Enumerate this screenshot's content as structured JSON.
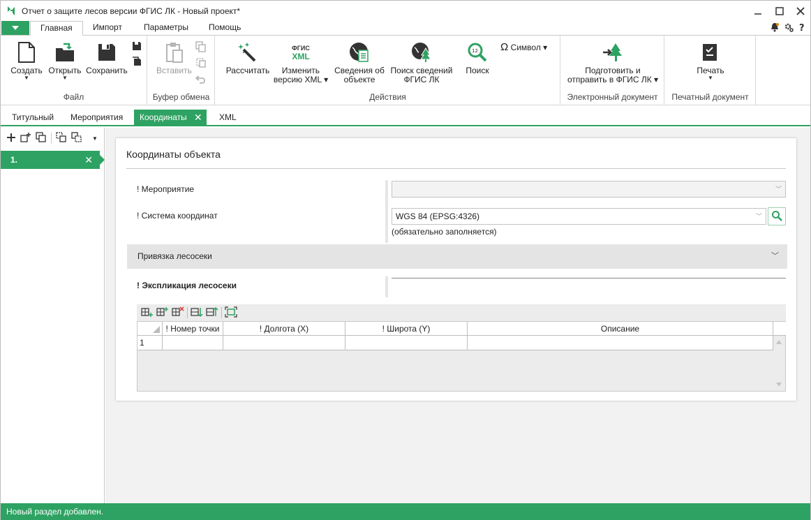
{
  "window": {
    "title": "Отчет о защите лесов версии ФГИС ЛК - Новый проект*",
    "accent_color": "#2ea262"
  },
  "ribbon_tabs": [
    "Главная",
    "Импорт",
    "Параметры",
    "Помощь"
  ],
  "ribbon": {
    "groups": {
      "file": "Файл",
      "clipboard": "Буфер обмена",
      "actions": "Действия",
      "edoc": "Электронный документ",
      "print": "Печатный документ"
    },
    "buttons": {
      "create": "Создать",
      "open": "Открыть",
      "save": "Сохранить",
      "paste": "Вставить",
      "calculate": "Рассчитать",
      "change_version_1": "Изменить",
      "change_version_2": "версию XML",
      "fgis_xml_icon_1": "ФГИС",
      "fgis_xml_icon_2": "XML",
      "object_info_1": "Сведения об",
      "object_info_2": "объекте",
      "search_fgis_1": "Поиск сведений",
      "search_fgis_2": "ФГИС ЛК",
      "search": "Поиск",
      "search_icon_num": "12",
      "symbol": "Символ",
      "prepare_send_1": "Подготовить и",
      "prepare_send_2": "отправить в ФГИС ЛК",
      "print": "Печать"
    }
  },
  "doc_tabs": [
    "Титульный",
    "Мероприятия",
    "Координаты",
    "XML"
  ],
  "active_doc_tab": "Координаты",
  "left_panel": {
    "items": [
      "1."
    ]
  },
  "form": {
    "title": "Координаты объекта",
    "event_label": "! Мероприятие",
    "event_value": "",
    "crs_label": "! Система координат",
    "crs_value": "WGS 84 (EPSG:4326)",
    "crs_hint": "(обязательно заполняется)",
    "section_binding": "Привязка лесосеки",
    "explication_label": "! Экспликация лесосеки",
    "table": {
      "columns": [
        "! Номер точки",
        "! Долгота (X)",
        "! Широта (Y)",
        "Описание"
      ],
      "rows": [
        {
          "num": "1",
          "point": "",
          "lon": "",
          "lat": "",
          "desc": ""
        }
      ]
    }
  },
  "status": "Новый раздел добавлен."
}
